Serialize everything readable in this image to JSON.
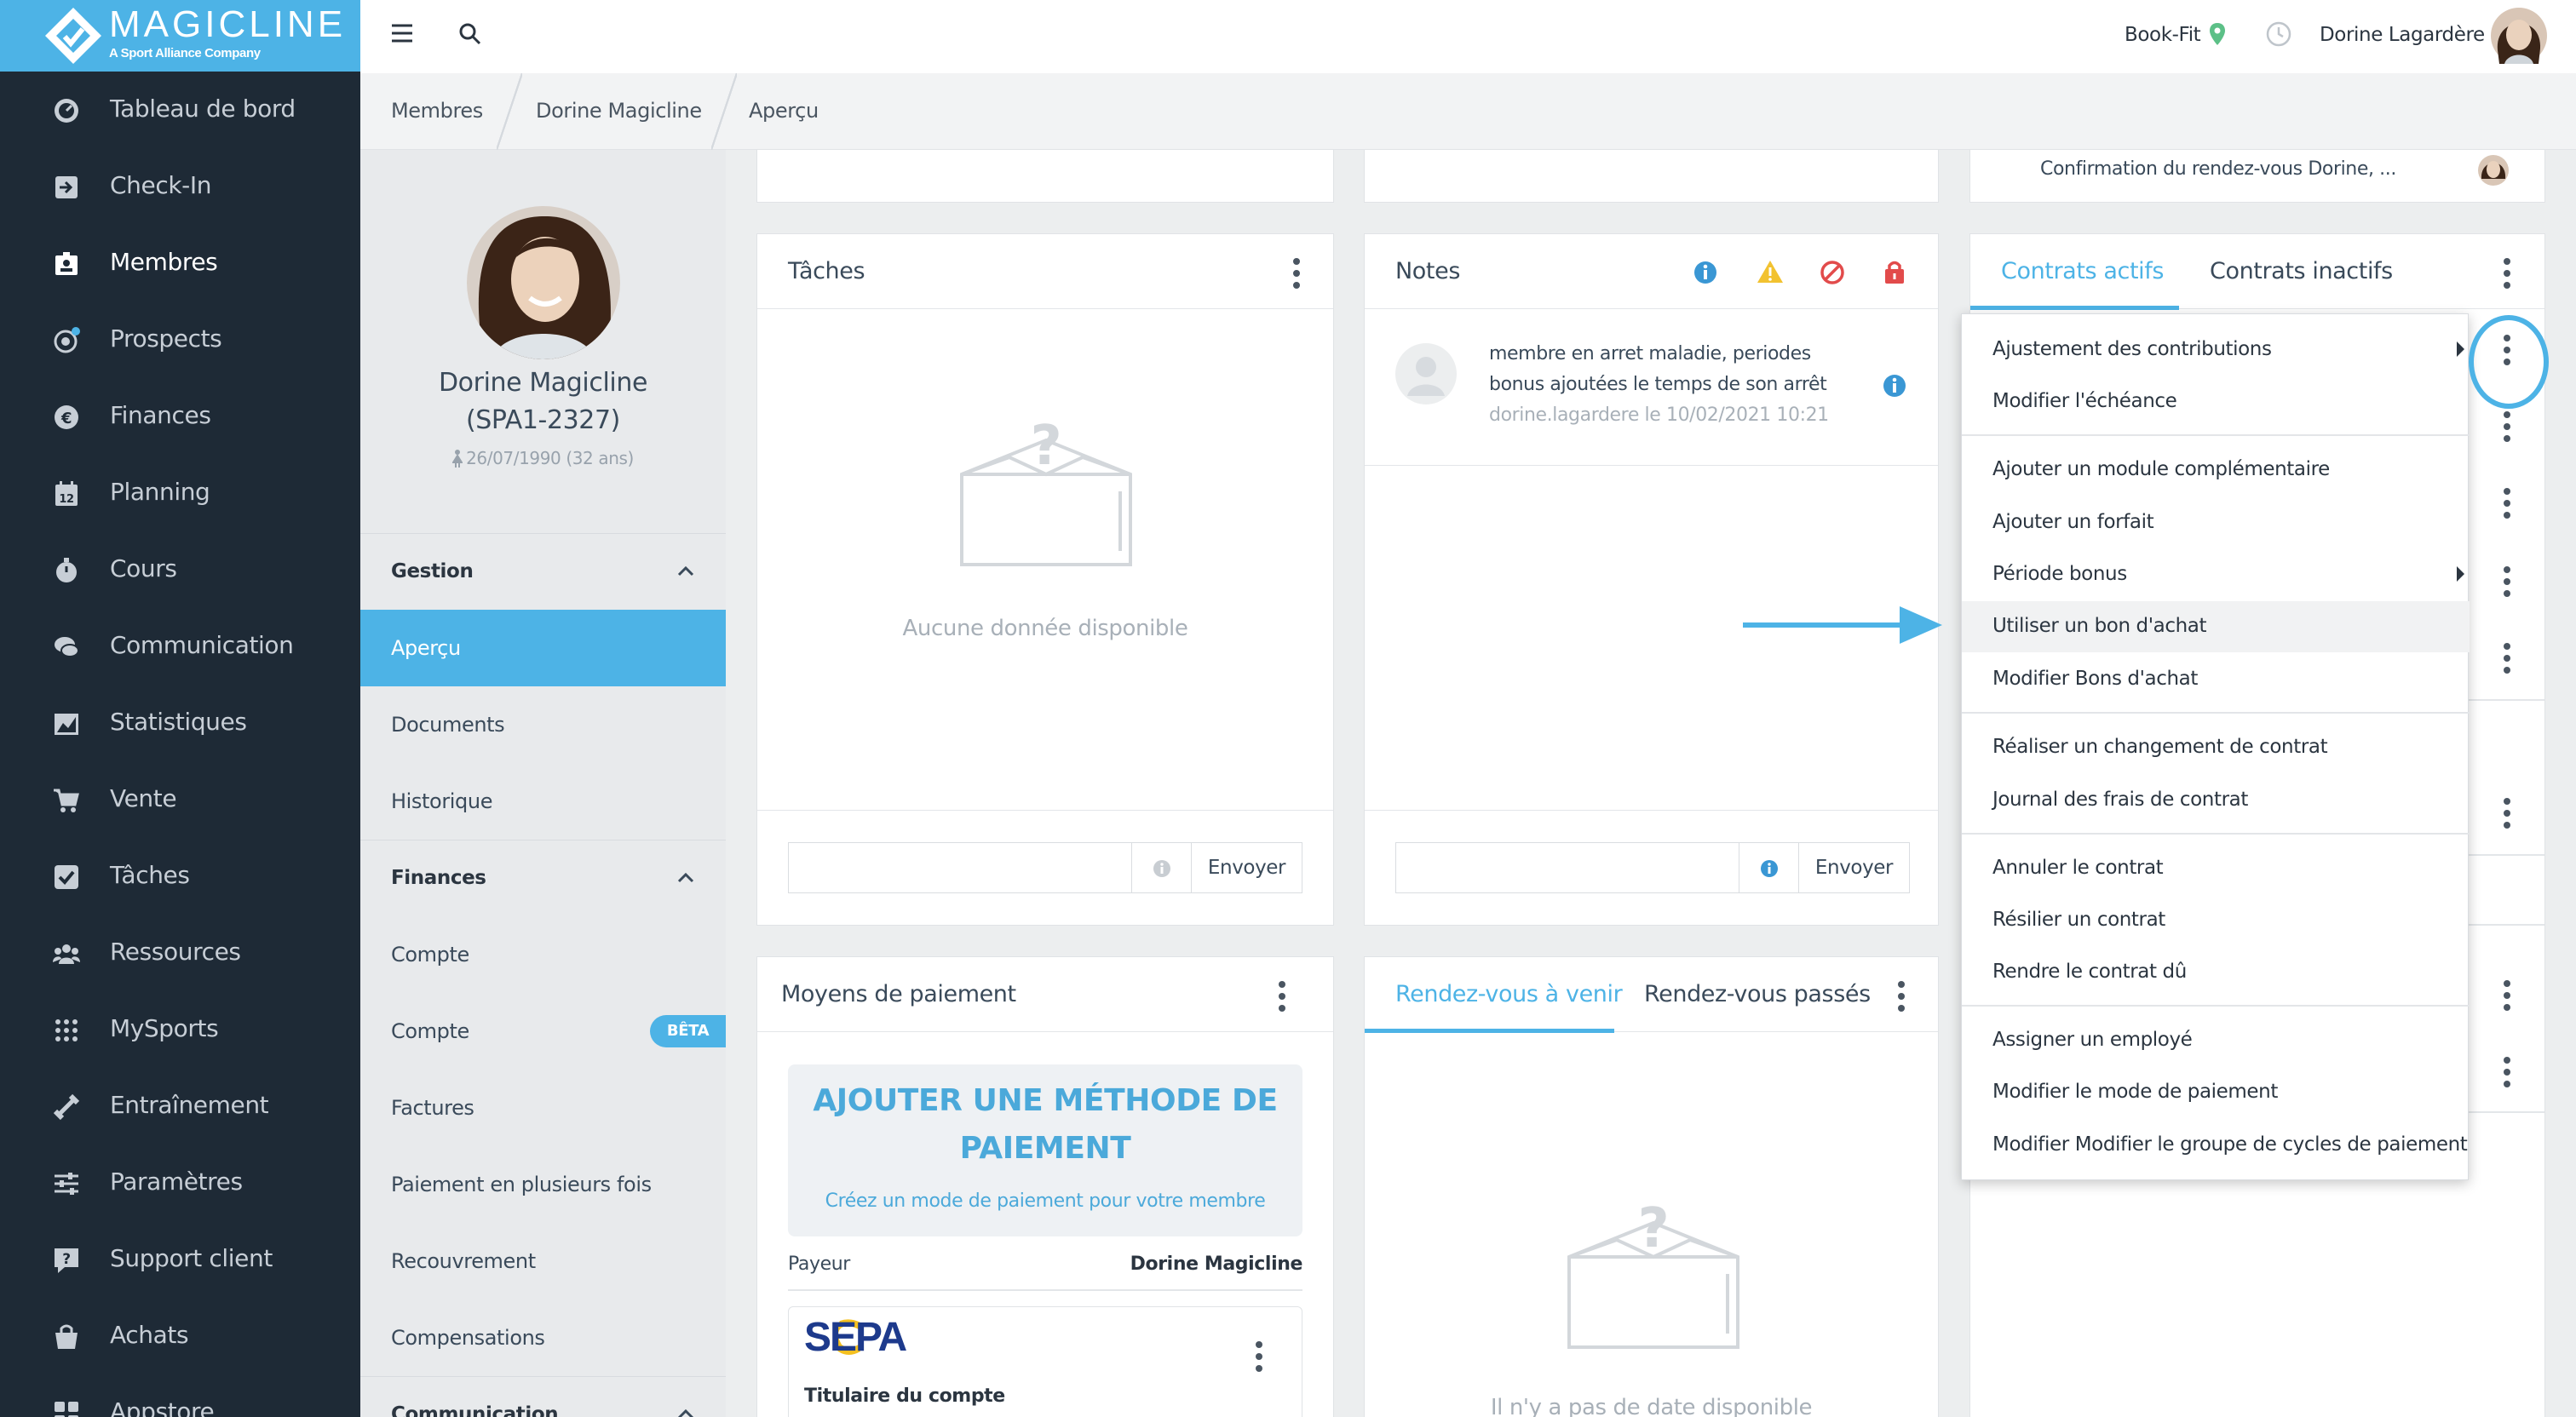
{
  "brand": {
    "name": "MAGICLINE",
    "tagline": "A Sport Alliance Company"
  },
  "sidebar": {
    "items": [
      {
        "label": "Tableau de bord",
        "icon": "dashboard-icon"
      },
      {
        "label": "Check-In",
        "icon": "checkin-icon"
      },
      {
        "label": "Membres",
        "icon": "members-icon"
      },
      {
        "label": "Prospects",
        "icon": "prospects-icon"
      },
      {
        "label": "Finances",
        "icon": "finances-icon"
      },
      {
        "label": "Planning",
        "icon": "calendar-icon"
      },
      {
        "label": "Cours",
        "icon": "stopwatch-icon"
      },
      {
        "label": "Communication",
        "icon": "chat-icon"
      },
      {
        "label": "Statistiques",
        "icon": "chart-icon"
      },
      {
        "label": "Vente",
        "icon": "cart-icon"
      },
      {
        "label": "Tâches",
        "icon": "checkbox-icon"
      },
      {
        "label": "Ressources",
        "icon": "group-icon"
      },
      {
        "label": "MySports",
        "icon": "dots-grid-icon"
      },
      {
        "label": "Entraînement",
        "icon": "dumbbell-icon"
      },
      {
        "label": "Paramètres",
        "icon": "sliders-icon"
      },
      {
        "label": "Support client",
        "icon": "help-icon"
      },
      {
        "label": "Achats",
        "icon": "basket-icon"
      },
      {
        "label": "Appstore",
        "icon": "apps-icon"
      }
    ],
    "active": "Membres"
  },
  "topbar": {
    "studio": "Book-Fit",
    "user": "Dorine Lagardère"
  },
  "breadcrumb": [
    "Membres",
    "Dorine Magicline",
    "Aperçu"
  ],
  "profile": {
    "name": "Dorine Magicline",
    "id": "(SPA1-2327)",
    "birth": "26/07/1990 (32 ans)"
  },
  "profile_menu": {
    "gestion": {
      "title": "Gestion",
      "items": [
        "Aperçu",
        "Documents",
        "Historique"
      ]
    },
    "finances": {
      "title": "Finances",
      "items": [
        "Compte",
        "Compte",
        "Factures",
        "Paiement en plusieurs fois",
        "Recouvrement",
        "Compensations"
      ],
      "beta_badge": "BÊTA"
    },
    "communication": {
      "title": "Communication"
    }
  },
  "top_right_card": {
    "text": "Confirmation du rendez-vous Dorine, ..."
  },
  "taches": {
    "title": "Tâches",
    "empty": "Aucune donnée disponible",
    "send": "Envoyer"
  },
  "notes": {
    "title": "Notes",
    "note_text_1": "membre en arret maladie, periodes",
    "note_text_2": "bonus ajoutées le temps de son arrêt",
    "note_meta": "dorine.lagardere le 10/02/2021 10:21",
    "send": "Envoyer"
  },
  "contrats": {
    "tab_active": "Contrats actifs",
    "tab_inactive": "Contrats inactifs"
  },
  "context_menu": {
    "items": [
      "Ajustement des contributions",
      "Modifier l'échéance",
      "Ajouter un module complémentaire",
      "Ajouter un forfait",
      "Période bonus",
      "Utiliser un bon d'achat",
      "Modifier Bons d'achat",
      "Réaliser un changement de contrat",
      "Journal des frais de contrat",
      "Annuler le contrat",
      "Résilier un contrat",
      "Rendre le contrat dû",
      "Assigner un employé",
      "Modifier le mode de paiement",
      "Modifier Modifier le groupe de cycles de paiement"
    ]
  },
  "paiement": {
    "title": "Moyens de paiement",
    "add_title_1": "AJOUTER UNE MÉTHODE DE",
    "add_title_2": "PAIEMENT",
    "add_sub": "Créez un mode de paiement pour votre membre",
    "payer_label": "Payeur",
    "payer_value": "Dorine Magicline",
    "sepa": "SEPA",
    "holder": "Titulaire du compte"
  },
  "rdv": {
    "tab_active": "Rendez-vous à venir",
    "tab_inactive": "Rendez-vous passés",
    "empty": "Il n'y a pas de date disponible"
  },
  "colors": {
    "accent": "#4db3e6",
    "sidebar": "#1e2a36",
    "annotation": "#4db3e6"
  }
}
